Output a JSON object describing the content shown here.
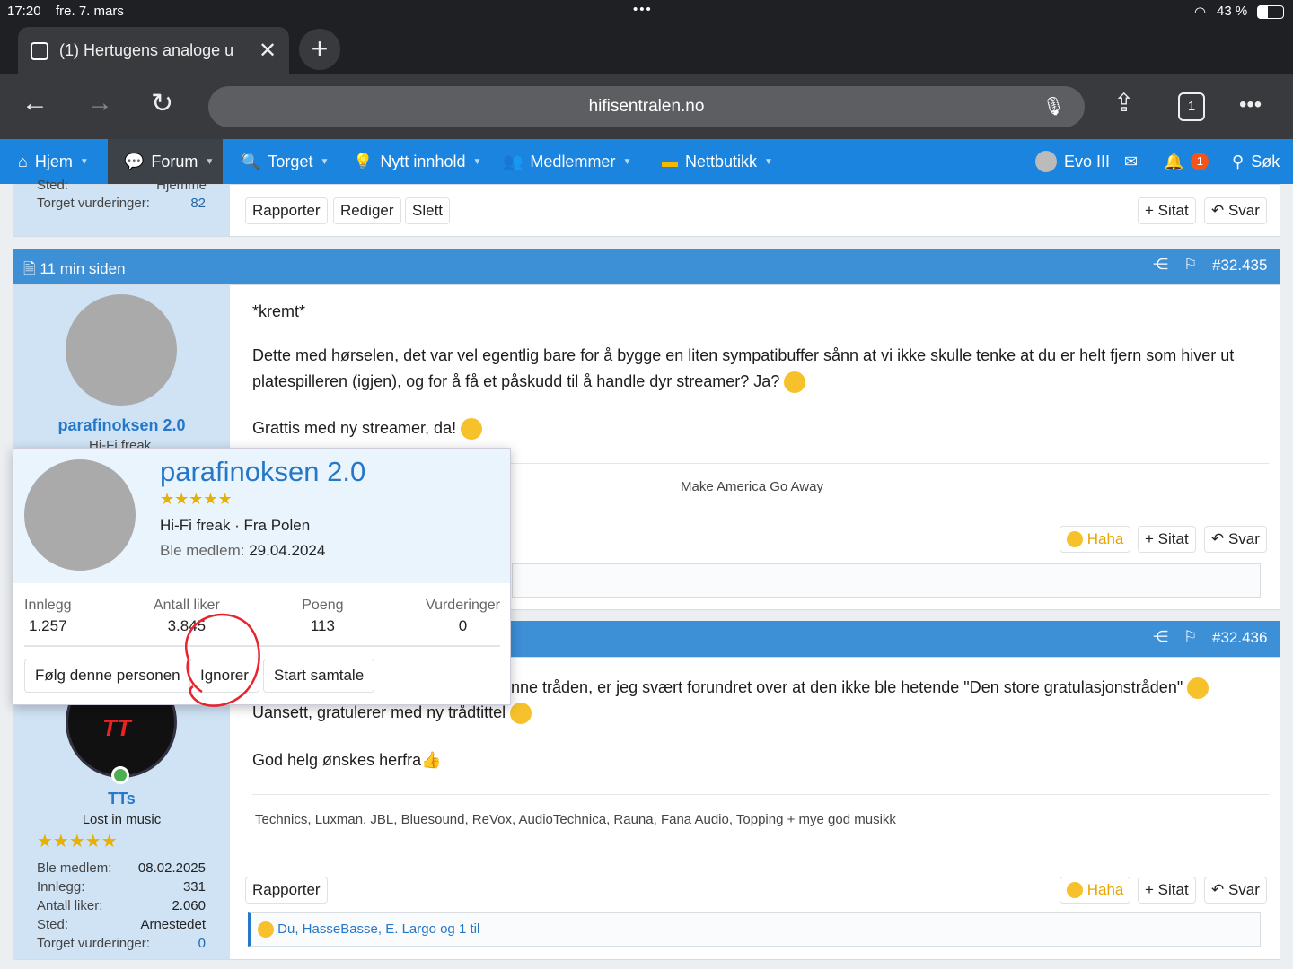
{
  "status": {
    "time": "17:20",
    "date": "fre. 7. mars",
    "battery": "43 %"
  },
  "tab": {
    "title": "(1) Hertugens analoge u"
  },
  "toolbar": {
    "url": "hifisentralen.no",
    "tab_count": "1"
  },
  "nav": {
    "items": [
      "Hjem",
      "Forum",
      "Torget",
      "Nytt innhold",
      "Medlemmer",
      "Nettbutikk"
    ],
    "user": "Evo III",
    "alerts": "1",
    "search": "Søk"
  },
  "post1": {
    "user_stats": [
      {
        "label": "Sted:",
        "value": "Hjemme"
      },
      {
        "label": "Torget vurderinger:",
        "value": "82"
      }
    ],
    "buttons": [
      "Rapporter",
      "Rediger",
      "Slett"
    ],
    "quote": "Sitat",
    "reply": "Svar"
  },
  "post2": {
    "time": "11 min siden",
    "number": "#32.435",
    "username": "parafinoksen 2.0",
    "user_title": "Hi-Fi freak",
    "lines": [
      "*kremt*",
      "Dette med hørselen, det var vel egentlig bare for å bygge en liten sympatibuffer sånn at vi ikke skulle tenke at du er helt fjern som hiver ut",
      "platespilleren (igjen), og for å få et påskudd til å handle dyr streamer? Ja?",
      "Grattis med ny streamer, da!"
    ],
    "signature": "Make America Go Away",
    "reaction": "Haha",
    "quote": "Sitat",
    "reply": "Svar"
  },
  "post3": {
    "number": "#32.436",
    "username": "TTs",
    "user_title": "Lost in music",
    "lines": [
      "nne tråden, er jeg svært forundret over at den ikke ble hetende \"Den store gratulasjonstråden\"",
      "Uansett, gratulerer med ny trådtittel",
      "God helg ønskes herfra"
    ],
    "signature": "Technics, Luxman, JBL, Bluesound, ReVox, AudioTechnica, Rauna, Fana Audio, Topping + mye god musikk",
    "stats": [
      {
        "label": "Ble medlem:",
        "value": "08.02.2025"
      },
      {
        "label": "Innlegg:",
        "value": "331"
      },
      {
        "label": "Antall liker:",
        "value": "2.060"
      },
      {
        "label": "Sted:",
        "value": "Arnestedet"
      },
      {
        "label": "Torget vurderinger:",
        "value": "0"
      }
    ],
    "report": "Rapporter",
    "reaction": "Haha",
    "quote": "Sitat",
    "reply": "Svar",
    "reactions_by": "Du, HasseBasse, E. Largo og 1 til"
  },
  "popup": {
    "name": "parafinoksen 2.0",
    "subtitle": "Hi-Fi freak · Fra Polen",
    "joined_label": "Ble medlem:",
    "joined": "29.04.2024",
    "stats": [
      {
        "label": "Innlegg",
        "value": "1.257"
      },
      {
        "label": "Antall liker",
        "value": "3.845"
      },
      {
        "label": "Poeng",
        "value": "113"
      },
      {
        "label": "Vurderinger",
        "value": "0"
      }
    ],
    "buttons": [
      "Følg denne personen",
      "Ignorer",
      "Start samtale"
    ]
  }
}
